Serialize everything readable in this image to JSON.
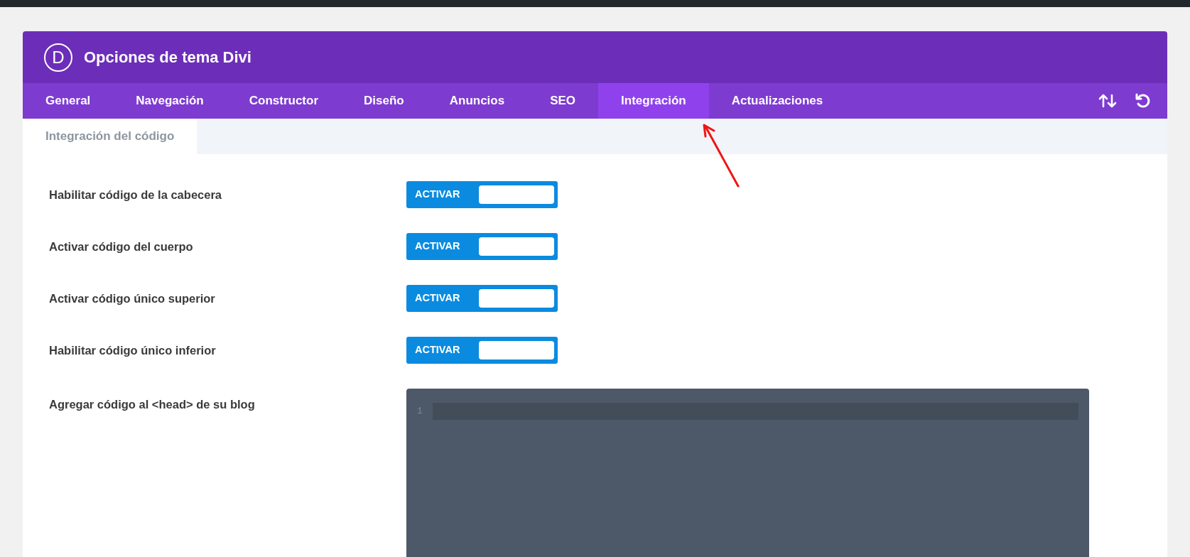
{
  "header": {
    "logo": "D",
    "title": "Opciones de tema Divi"
  },
  "tabs": [
    {
      "label": "General",
      "selected": false
    },
    {
      "label": "Navegación",
      "selected": false
    },
    {
      "label": "Constructor",
      "selected": false
    },
    {
      "label": "Diseño",
      "selected": false
    },
    {
      "label": "Anuncios",
      "selected": false
    },
    {
      "label": "SEO",
      "selected": false
    },
    {
      "label": "Integración",
      "selected": true
    },
    {
      "label": "Actualizaciones",
      "selected": false
    }
  ],
  "subtabs": [
    {
      "label": "Integración del código",
      "selected": true
    }
  ],
  "settings": [
    {
      "kind": "toggle",
      "label": "Habilitar código de la cabecera",
      "toggle_text": "ACTIVAR",
      "on": true
    },
    {
      "kind": "toggle",
      "label": "Activar código del cuerpo",
      "toggle_text": "ACTIVAR",
      "on": true
    },
    {
      "kind": "toggle",
      "label": "Activar código único superior",
      "toggle_text": "ACTIVAR",
      "on": true
    },
    {
      "kind": "toggle",
      "label": "Habilitar código único inferior",
      "toggle_text": "ACTIVAR",
      "on": true
    },
    {
      "kind": "code",
      "label": "Agregar código al <head> de su blog",
      "line_numbers": [
        "1"
      ]
    }
  ]
}
